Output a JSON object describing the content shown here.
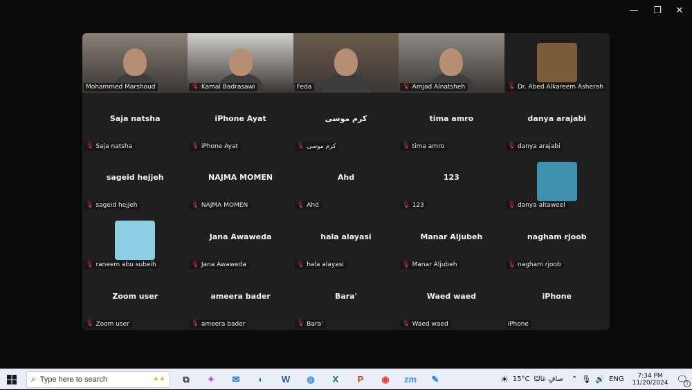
{
  "window_controls": {
    "minimize": "—",
    "restore": "❐",
    "close": "✕"
  },
  "tiles": [
    {
      "type": "video",
      "label": "Mohammed Marshoud",
      "muted": false,
      "bg": "#8a8075"
    },
    {
      "type": "video",
      "label": "Kamal Badrasawi",
      "muted": true,
      "bg": "#cfcfcf"
    },
    {
      "type": "video",
      "label": "Feda",
      "muted": false,
      "active": true,
      "bg": "#6b5b4c"
    },
    {
      "type": "video",
      "label": "Amjad Alnatsheh",
      "muted": true,
      "bg": "#8e8b86"
    },
    {
      "type": "avatar",
      "label": "Dr. Abed Alkareem Asherah",
      "muted": true,
      "avatar_bg": "#7a5b3a"
    },
    {
      "type": "name",
      "name": "Saja natsha",
      "label": "Saja natsha",
      "muted": true
    },
    {
      "type": "name",
      "name": "iPhone Ayat",
      "label": "iPhone Ayat",
      "muted": true
    },
    {
      "type": "name",
      "name": "كرم موسى",
      "label": "كرم موسى",
      "muted": true
    },
    {
      "type": "name",
      "name": "tima amro",
      "label": "tima amro",
      "muted": true
    },
    {
      "type": "name",
      "name": "danya arajabi",
      "label": "danya arajabi",
      "muted": true
    },
    {
      "type": "name",
      "name": "sageid hejjeh",
      "label": "sageid hejjeh",
      "muted": true
    },
    {
      "type": "name",
      "name": "NAJMA MOMEN",
      "label": "NAJMA MOMEN",
      "muted": true
    },
    {
      "type": "name",
      "name": "Ahd",
      "label": "Ahd",
      "muted": true
    },
    {
      "type": "name",
      "name": "123",
      "label": "123",
      "muted": true
    },
    {
      "type": "avatar",
      "label": "danya altaweel",
      "muted": true,
      "avatar_bg": "#3f8fb0"
    },
    {
      "type": "avatar",
      "label": "raneem abu subeih",
      "muted": true,
      "avatar_bg": "#8ecfe6"
    },
    {
      "type": "name",
      "name": "Jana Awaweda",
      "label": "Jana Awaweda",
      "muted": true
    },
    {
      "type": "name",
      "name": "hala alayasi",
      "label": "hala alayasi",
      "muted": true
    },
    {
      "type": "name",
      "name": "Manar Aljubeh",
      "label": "Manar Aljubeh",
      "muted": true
    },
    {
      "type": "name",
      "name": "nagham rjoob",
      "label": "nagham rjoob",
      "muted": true
    },
    {
      "type": "name",
      "name": "Zoom user",
      "label": "Zoom user",
      "muted": true
    },
    {
      "type": "name",
      "name": "ameera bader",
      "label": "ameera bader",
      "muted": true
    },
    {
      "type": "name",
      "name": "Bara'",
      "label": "Bara'",
      "muted": true
    },
    {
      "type": "name",
      "name": "Waed waed",
      "label": "Waed waed",
      "muted": true
    },
    {
      "type": "name",
      "name": "iPhone",
      "label": "iPhone",
      "muted": false
    }
  ],
  "taskbar": {
    "search_placeholder": "Type here to search",
    "apps": [
      "task-view-icon",
      "copilot-icon",
      "mail-icon",
      "edge-icon",
      "word-icon",
      "photos-icon",
      "excel-icon",
      "powerpoint-icon",
      "chrome-icon",
      "zoom-icon",
      "paint-icon"
    ],
    "app_glyphs": [
      "⧉",
      "✦",
      "✉",
      "◐",
      "W",
      "◍",
      "X",
      "P",
      "◉",
      "zm",
      "✎"
    ],
    "app_colors": [
      "#333",
      "#a35cf0",
      "#1c6fd1",
      "#1a8f6a",
      "#2b579a",
      "#3b8ed8",
      "#217346",
      "#c43e1c",
      "#db4437",
      "#2d8cff",
      "#1e88e5"
    ],
    "weather_temp": "15°C",
    "weather_text": "صافٍ غالبًا",
    "language": "ENG",
    "time": "7:34 PM",
    "date": "11/20/2024",
    "notification_count": "1"
  }
}
